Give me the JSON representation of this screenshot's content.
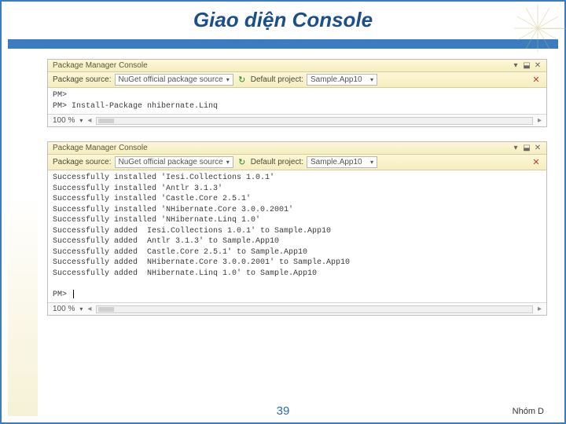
{
  "slide": {
    "title": "Giao diện Console",
    "page_number": "39",
    "footer_right": "Nhóm D"
  },
  "panel1": {
    "title": "Package Manager Console",
    "source_label": "Package source:",
    "source_value": "NuGet official package source",
    "project_label": "Default project:",
    "project_value": "Sample.App10",
    "lines": [
      "PM>",
      "PM> Install-Package nhibernate.Linq"
    ],
    "zoom": "100 %"
  },
  "panel2": {
    "title": "Package Manager Console",
    "source_label": "Package source:",
    "source_value": "NuGet official package source",
    "project_label": "Default project:",
    "project_value": "Sample.App10",
    "lines": [
      "Successfully installed 'Iesi.Collections 1.0.1'",
      "Successfully installed 'Antlr 3.1.3'",
      "Successfully installed 'Castle.Core 2.5.1'",
      "Successfully installed 'NHibernate.Core 3.0.0.2001'",
      "Successfully installed 'NHibernate.Linq 1.0'",
      "Successfully added  Iesi.Collections 1.0.1' to Sample.App10",
      "Successfully added  Antlr 3.1.3' to Sample.App10",
      "Successfully added  Castle.Core 2.5.1' to Sample.App10",
      "Successfully added  NHibernate.Core 3.0.0.2001' to Sample.App10",
      "Successfully added  NHibernate.Linq 1.0' to Sample.App10",
      "",
      "PM> "
    ],
    "zoom": "100 %"
  },
  "icons": {
    "refresh": "↻",
    "clear": "✕",
    "pin": "📌",
    "dropdown": "▾",
    "close": "✕"
  }
}
